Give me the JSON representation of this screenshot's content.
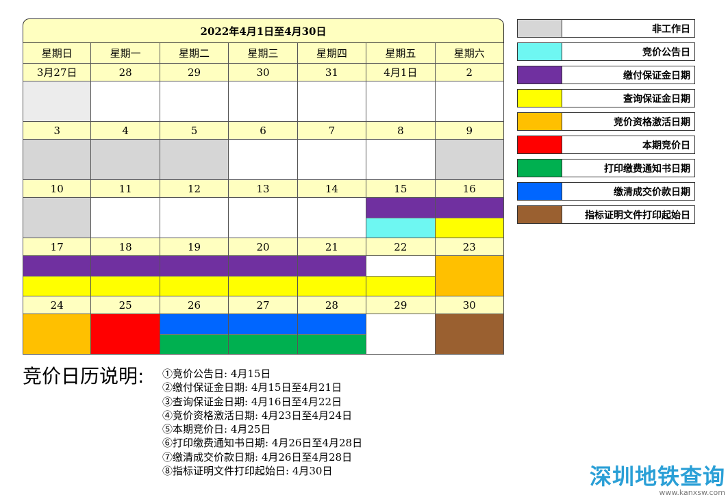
{
  "colors": {
    "header_bg": "#ffffc0",
    "non_work": "#d6d6d6",
    "light_gray": "#ececec",
    "announce": "#6ef7f2",
    "pay_deposit": "#7030a0",
    "query_deposit": "#ffff00",
    "activate": "#ffc000",
    "bid": "#ff0000",
    "print_notice": "#00b050",
    "pay_price": "#0066ff",
    "print_docs": "#9a6030",
    "white": "#ffffff"
  },
  "calendar": {
    "title": "2022年4月1日至4月30日",
    "weekdays": [
      "星期日",
      "星期一",
      "星期二",
      "星期三",
      "星期四",
      "星期五",
      "星期六"
    ],
    "weeks": [
      [
        {
          "label": "3月27日",
          "bands": [
            "light_gray"
          ]
        },
        {
          "label": "28",
          "bands": [
            "white"
          ]
        },
        {
          "label": "29",
          "bands": [
            "white"
          ]
        },
        {
          "label": "30",
          "bands": [
            "white"
          ]
        },
        {
          "label": "31",
          "bands": [
            "white"
          ]
        },
        {
          "label": "4月1日",
          "bands": [
            "white"
          ]
        },
        {
          "label": "2",
          "bands": [
            "white"
          ]
        }
      ],
      [
        {
          "label": "3",
          "bands": [
            "non_work"
          ]
        },
        {
          "label": "4",
          "bands": [
            "non_work"
          ]
        },
        {
          "label": "5",
          "bands": [
            "non_work"
          ]
        },
        {
          "label": "6",
          "bands": [
            "white"
          ]
        },
        {
          "label": "7",
          "bands": [
            "white"
          ]
        },
        {
          "label": "8",
          "bands": [
            "white"
          ]
        },
        {
          "label": "9",
          "bands": [
            "non_work"
          ]
        }
      ],
      [
        {
          "label": "10",
          "bands": [
            "non_work"
          ]
        },
        {
          "label": "11",
          "bands": [
            "white"
          ]
        },
        {
          "label": "12",
          "bands": [
            "white"
          ]
        },
        {
          "label": "13",
          "bands": [
            "white"
          ]
        },
        {
          "label": "14",
          "bands": [
            "white"
          ]
        },
        {
          "label": "15",
          "bands": [
            "pay_deposit",
            "announce"
          ]
        },
        {
          "label": "16",
          "bands": [
            "pay_deposit",
            "query_deposit"
          ]
        }
      ],
      [
        {
          "label": "17",
          "bands": [
            "pay_deposit",
            "query_deposit"
          ]
        },
        {
          "label": "18",
          "bands": [
            "pay_deposit",
            "query_deposit"
          ]
        },
        {
          "label": "19",
          "bands": [
            "pay_deposit",
            "query_deposit"
          ]
        },
        {
          "label": "20",
          "bands": [
            "pay_deposit",
            "query_deposit"
          ]
        },
        {
          "label": "21",
          "bands": [
            "pay_deposit",
            "query_deposit"
          ]
        },
        {
          "label": "22",
          "bands": [
            "white",
            "query_deposit"
          ]
        },
        {
          "label": "23",
          "bands": [
            "activate"
          ]
        }
      ],
      [
        {
          "label": "24",
          "bands": [
            "activate"
          ]
        },
        {
          "label": "25",
          "bands": [
            "bid"
          ]
        },
        {
          "label": "26",
          "bands": [
            "pay_price",
            "print_notice"
          ]
        },
        {
          "label": "27",
          "bands": [
            "pay_price",
            "print_notice"
          ]
        },
        {
          "label": "28",
          "bands": [
            "pay_price",
            "print_notice"
          ]
        },
        {
          "label": "29",
          "bands": [
            "white"
          ]
        },
        {
          "label": "30",
          "bands": [
            "print_docs"
          ]
        }
      ]
    ]
  },
  "legend": [
    {
      "label": "非工作日",
      "color": "#d6d6d6"
    },
    {
      "label": "竞价公告日",
      "color": "#6ef7f2"
    },
    {
      "label": "缴付保证金日期",
      "color": "#7030a0"
    },
    {
      "label": "查询保证金日期",
      "color": "#ffff00"
    },
    {
      "label": "竞价资格激活日期",
      "color": "#ffc000"
    },
    {
      "label": "本期竞价日",
      "color": "#ff0000"
    },
    {
      "label": "打印缴费通知书日期",
      "color": "#00b050"
    },
    {
      "label": "缴清成交价款日期",
      "color": "#0066ff"
    },
    {
      "label": "指标证明文件打印起始日",
      "color": "#9a6030"
    }
  ],
  "notes": {
    "heading": "竞价日历说明:",
    "items": [
      "①竞价公告日: 4月15日",
      "②缴付保证金日期: 4月15日至4月21日",
      "③查询保证金日期: 4月16日至4月22日",
      "④竞价资格激活日期: 4月23日至4月24日",
      "⑤本期竞价日: 4月25日",
      "⑥打印缴费通知书日期: 4月26日至4月28日",
      "⑦缴清成交价款日期: 4月26日至4月28日",
      "⑧指标证明文件打印起始日: 4月30日"
    ]
  },
  "watermark": {
    "main": "深圳地铁查询",
    "url": "www.kanxsw.com"
  }
}
